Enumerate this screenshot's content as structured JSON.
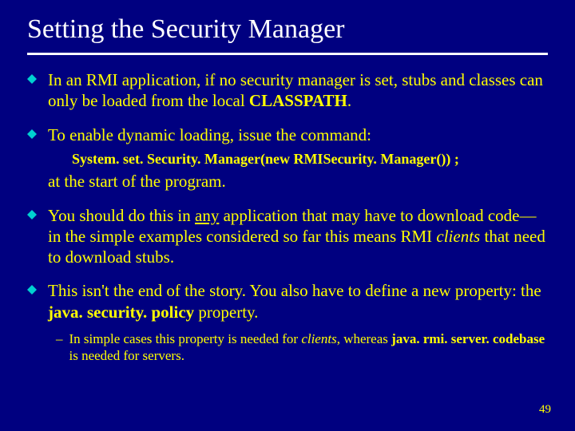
{
  "title": "Setting the Security Manager",
  "bullets": {
    "b1_a": "In an RMI application, if no security manager is set, stubs and classes can only be loaded from the local ",
    "b1_b": "CLASSPATH",
    "b1_c": ".",
    "b2_a": "To enable dynamic loading, issue the command:",
    "b2_code": "System. set. Security. Manager(new RMISecurity. Manager()) ;",
    "b2_b": "at the start of the program.",
    "b3_a": "You should do this in ",
    "b3_any": "any",
    "b3_b": " application that may have to download code—in the simple examples considered so far this means RMI ",
    "b3_clients": "clients",
    "b3_c": " that need to download stubs.",
    "b4_a": "This isn't the end of the story.  You also have to define a new property: the ",
    "b4_prop": "java. security. policy",
    "b4_b": " property.",
    "sub_a": "In simple cases this property is needed for ",
    "sub_clients": "clients",
    "sub_b": ", whereas ",
    "sub_cb": "java. rmi. server. codebase",
    "sub_c": " is needed for servers."
  },
  "page_number": "49"
}
